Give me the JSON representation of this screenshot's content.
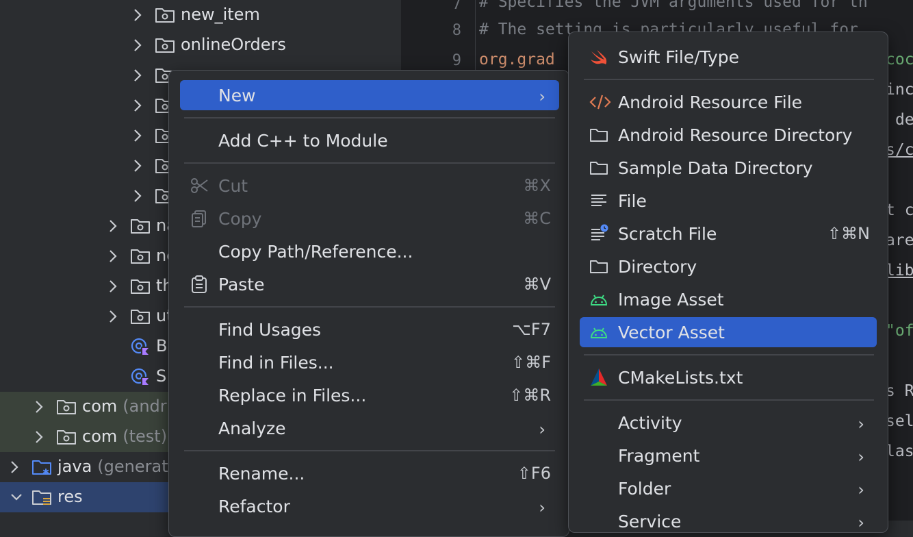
{
  "tree": {
    "rows": [
      {
        "label": "new_item"
      },
      {
        "label": "onlineOrders"
      },
      {
        "label": ""
      },
      {
        "label": ""
      },
      {
        "label": ""
      },
      {
        "label": ""
      },
      {
        "label": ""
      },
      {
        "label": "na"
      },
      {
        "label": "ne"
      },
      {
        "label": "th"
      },
      {
        "label": "ut"
      },
      {
        "label": "B"
      },
      {
        "label": "S"
      },
      {
        "label": "com",
        "suffix": "(andr"
      },
      {
        "label": "com",
        "suffix": "(test)"
      },
      {
        "label": "java",
        "suffix": "(generat"
      },
      {
        "label": "res"
      }
    ]
  },
  "editor": {
    "line_numbers": [
      "7",
      "8",
      "9"
    ],
    "lines": [
      "# Specifies the JVM arguments used for th",
      "# The setting is particularly useful for",
      "org.grad"
    ],
    "fragments": [
      "coc",
      "inc",
      "de",
      "s/c",
      "t c",
      "are",
      "lib",
      "\"of",
      "s R",
      "sel",
      "las"
    ]
  },
  "menu_main": {
    "items": [
      {
        "label": "New",
        "shortcut": "",
        "submenu": true,
        "active": true
      },
      {
        "label": "Add C++ to Module",
        "shortcut": ""
      },
      {
        "label": "Cut",
        "shortcut": "⌘X",
        "disabled": true,
        "icon": "scissors-icon"
      },
      {
        "label": "Copy",
        "shortcut": "⌘C",
        "disabled": true,
        "icon": "copy-icon"
      },
      {
        "label": "Copy Path/Reference...",
        "shortcut": ""
      },
      {
        "label": "Paste",
        "shortcut": "⌘V",
        "icon": "clipboard-icon"
      },
      {
        "label": "Find Usages",
        "shortcut": "⌥F7"
      },
      {
        "label": "Find in Files...",
        "shortcut": "⇧⌘F"
      },
      {
        "label": "Replace in Files...",
        "shortcut": "⇧⌘R"
      },
      {
        "label": "Analyze",
        "shortcut": "",
        "submenu": true
      },
      {
        "label": "Rename...",
        "shortcut": "⇧F6"
      },
      {
        "label": "Refactor",
        "shortcut": "",
        "submenu": true
      }
    ]
  },
  "menu_new": {
    "items": [
      {
        "label": "Swift File/Type",
        "icon": "swift-icon"
      },
      {
        "label": "Android Resource File",
        "icon": "code-brackets-icon"
      },
      {
        "label": "Android Resource Directory",
        "icon": "folder-icon"
      },
      {
        "label": "Sample Data Directory",
        "icon": "folder-icon"
      },
      {
        "label": "File",
        "icon": "text-file-icon"
      },
      {
        "label": "Scratch File",
        "icon": "scratch-file-icon",
        "shortcut": "⇧⌘N"
      },
      {
        "label": "Directory",
        "icon": "folder-icon"
      },
      {
        "label": "Image Asset",
        "icon": "android-icon"
      },
      {
        "label": "Vector Asset",
        "icon": "android-icon",
        "active": true
      },
      {
        "label": "CMakeLists.txt",
        "icon": "cmake-icon"
      },
      {
        "label": "Activity",
        "submenu": true
      },
      {
        "label": "Fragment",
        "submenu": true
      },
      {
        "label": "Folder",
        "submenu": true
      },
      {
        "label": "Service",
        "submenu": true
      }
    ]
  },
  "colors": {
    "selection": "#2f5fca",
    "menu_bg": "#2b2d30",
    "editor_bg": "#1e1f22",
    "android_green": "#3ddc84",
    "swift_orange": "#f05138"
  }
}
